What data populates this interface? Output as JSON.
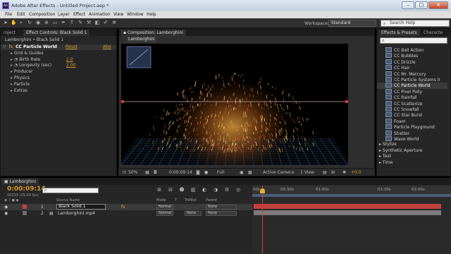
{
  "app": {
    "title": "Adobe After Effects - Untitled Project.aep *",
    "logo_text": "Ae",
    "window_buttons": [
      "–",
      "□",
      "✕"
    ]
  },
  "menu": [
    "File",
    "Edit",
    "Composition",
    "Layer",
    "Effect",
    "Animation",
    "View",
    "Window",
    "Help"
  ],
  "toolbar": {
    "workspace_label": "Workspace:",
    "workspace_value": "Standard",
    "search_placeholder": "Search Help"
  },
  "left_panel": {
    "tab_project": "roject",
    "tab_effect_controls": "Effect Controls: Black Solid 1",
    "breadcrumb": "Lamborghini • Black Solid 1",
    "effect_name": "CC Particle World",
    "reset_label": "Reset",
    "about_label": "Abo",
    "fx_badge": "fx",
    "props": [
      {
        "label": "Grid & Guides",
        "value": ""
      },
      {
        "label": "Birth Rate",
        "value": "2.0"
      },
      {
        "label": "Longevity (sec)",
        "value": "2.00"
      },
      {
        "label": "Producer",
        "value": ""
      },
      {
        "label": "Physics",
        "value": ""
      },
      {
        "label": "Particle",
        "value": ""
      },
      {
        "label": "Extras",
        "value": ""
      }
    ]
  },
  "comp_panel": {
    "tab_label": "Composition: Lamborghini",
    "sub_tab": "Lamborghini",
    "zoom": "50%",
    "timecode": "0:00:09:14",
    "resolution": "Full",
    "camera": "Active Camera",
    "views": "1 View",
    "exposure": "+0.0"
  },
  "effects_presets": {
    "tab_label": "Effects & Presets",
    "tab_characters": "Characte",
    "search_value": "",
    "items": [
      "CC Ball Action",
      "CC Bubbles",
      "CC Drizzle",
      "CC Hair",
      "CC Mr. Mercury",
      "CC Particle Systems II",
      "CC Particle World",
      "CC Pixel Polly",
      "CC Rainfall",
      "CC Scatterize",
      "CC Snowfall",
      "CC Star Burst",
      "Foam",
      "Particle Playground",
      "Shatter",
      "Wave World"
    ],
    "selected": "CC Particle World",
    "categories": [
      "Stylize",
      "Synthetic Aperture",
      "Text",
      "Time"
    ]
  },
  "timeline": {
    "tab_label": "Lamborghini",
    "timecode": "0:00:09:14",
    "fps_info": "00239 (25.00 fps)",
    "search_value": "",
    "columns": {
      "source_name": "Source Name",
      "mode": "Mode",
      "t": "T",
      "trkmat": "TrkMat",
      "parent": "Parent"
    },
    "ruler": [
      "0:00s",
      "00:30s",
      "01:00s",
      "01:30s",
      "02:00s"
    ],
    "ruler_start": "00s",
    "layers": [
      {
        "num": "1",
        "name": "Black Solid 1",
        "mode": "Normal",
        "trkmat": "",
        "parent": "None",
        "color": "#c2413f"
      },
      {
        "num": "2",
        "name": "Lamborghini.mp4",
        "mode": "Normal",
        "trkmat": "None",
        "parent": "None",
        "color": "#6c6c6c"
      }
    ]
  },
  "colors": {
    "accent_orange": "#d49a2f",
    "layer1_bar": "#c2413f",
    "layer2_bar": "#7b7b7b",
    "playhead": "#e03a2f",
    "workarea": "#4a5e7a"
  }
}
